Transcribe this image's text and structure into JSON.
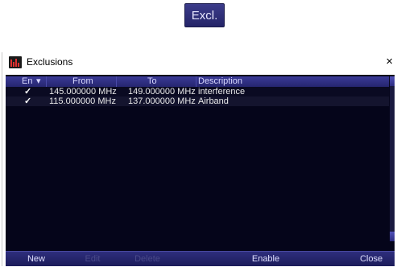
{
  "excl_button": {
    "label": "Excl."
  },
  "window": {
    "title": "Exclusions",
    "close_glyph": "×"
  },
  "table": {
    "columns": [
      "En",
      "From",
      "To",
      "Description"
    ],
    "sort_glyph": "▾",
    "check_glyph": "✓",
    "rows": [
      {
        "enabled": true,
        "from": "145.000000 MHz",
        "to": "149.000000 MHz",
        "description": "interference"
      },
      {
        "enabled": true,
        "from": "115.000000 MHz",
        "to": "137.000000 MHz",
        "description": "Airband"
      }
    ]
  },
  "buttons": {
    "new": "New",
    "edit": "Edit",
    "delete": "Delete",
    "enable": "Enable",
    "close": "Close"
  },
  "colors": {
    "panel_bg": "#05051a",
    "header_bg": "#3a3a96",
    "button_bg": "#2e2e7c",
    "disabled_text": "#4a4a8a"
  }
}
